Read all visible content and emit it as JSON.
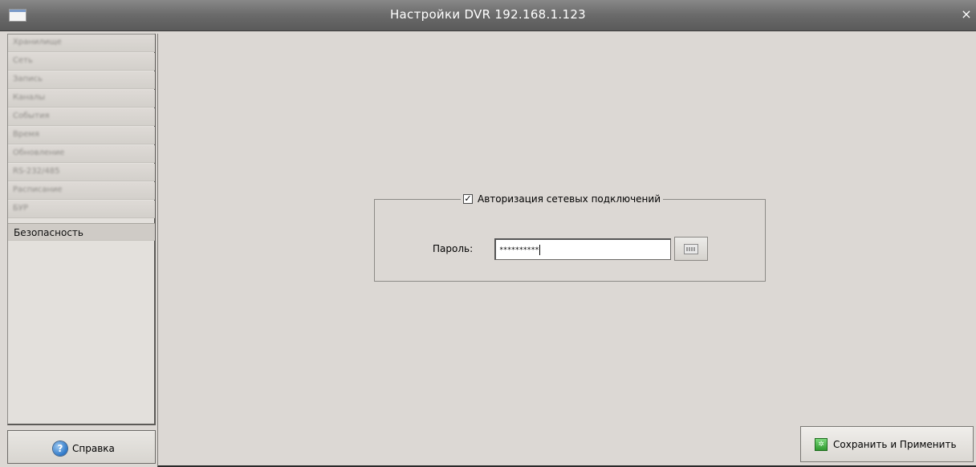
{
  "window": {
    "title": "Настройки DVR 192.168.1.123",
    "close_glyph": "×"
  },
  "sidebar": {
    "items": [
      {
        "label": "Хранилище",
        "blurred": true
      },
      {
        "label": "Сеть",
        "blurred": true
      },
      {
        "label": "Запись",
        "blurred": true
      },
      {
        "label": "Каналы",
        "blurred": true
      },
      {
        "label": "События",
        "blurred": true
      },
      {
        "label": "Время",
        "blurred": true
      },
      {
        "label": "Обновление",
        "blurred": true
      },
      {
        "label": "RS-232/485",
        "blurred": true
      },
      {
        "label": "Расписание",
        "blurred": true
      },
      {
        "label": "БУР",
        "blurred": true
      },
      {
        "label": "Безопасность",
        "blurred": false,
        "active": true
      }
    ],
    "help_button": {
      "label": "Справка",
      "icon": "help-icon",
      "glyph": "?"
    }
  },
  "security": {
    "auth_checkbox": {
      "label": "Авторизация сетевых подключений",
      "checked": true,
      "glyph": "✓"
    },
    "password": {
      "label": "Пароль:",
      "value": "**********"
    },
    "keyboard_button": {
      "icon": "keyboard-icon"
    }
  },
  "footer": {
    "save_button": {
      "label": "Сохранить и Применить",
      "icon": "save-apply-icon",
      "glyph": "✲"
    }
  },
  "colors": {
    "titlebar": "#6a6a6a",
    "background": "#dcd8d4",
    "sidebar": "#e3e0dc",
    "save_icon": "#2f9a2f",
    "help_icon": "#2e78c8"
  }
}
